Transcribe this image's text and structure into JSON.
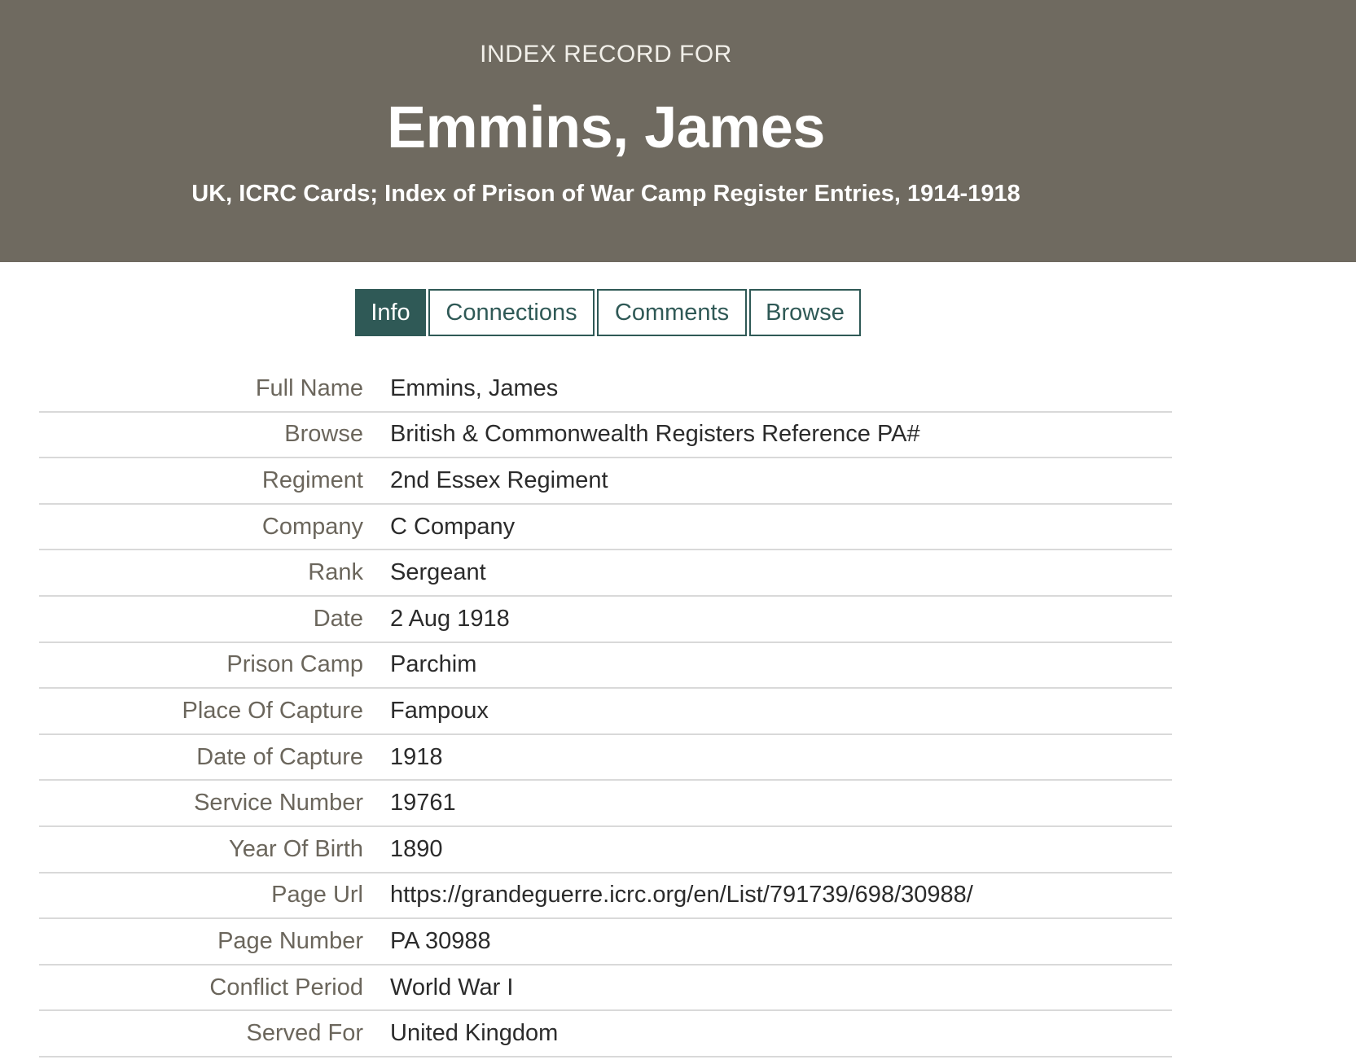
{
  "header": {
    "pre_title": "INDEX RECORD FOR",
    "name": "Emmins, James",
    "collection": "UK, ICRC Cards; Index of Prison of War Camp Register Entries, 1914-1918"
  },
  "tabs": [
    {
      "label": "Info",
      "active": true
    },
    {
      "label": "Connections",
      "active": false
    },
    {
      "label": "Comments",
      "active": false
    },
    {
      "label": "Browse",
      "active": false
    }
  ],
  "records": [
    {
      "label": "Full Name",
      "value": "Emmins, James"
    },
    {
      "label": "Browse",
      "value": "British & Commonwealth Registers Reference PA#"
    },
    {
      "label": "Regiment",
      "value": "2nd Essex Regiment"
    },
    {
      "label": "Company",
      "value": "C Company"
    },
    {
      "label": "Rank",
      "value": "Sergeant"
    },
    {
      "label": "Date",
      "value": "2 Aug 1918"
    },
    {
      "label": "Prison Camp",
      "value": "Parchim"
    },
    {
      "label": "Place Of Capture",
      "value": "Fampoux"
    },
    {
      "label": "Date of Capture",
      "value": "1918"
    },
    {
      "label": "Service Number",
      "value": "19761"
    },
    {
      "label": "Year Of Birth",
      "value": "1890"
    },
    {
      "label": "Page Url",
      "value": "https://grandeguerre.icrc.org/en/List/791739/698/30988/"
    },
    {
      "label": "Page Number",
      "value": "PA 30988"
    },
    {
      "label": "Conflict Period",
      "value": "World War I"
    },
    {
      "label": "Served For",
      "value": "United Kingdom"
    }
  ],
  "colors": {
    "hero_background": "#6f6a60",
    "tab_accent": "#2f5956",
    "label_text": "#6b665c",
    "divider": "#d9d9d9"
  }
}
